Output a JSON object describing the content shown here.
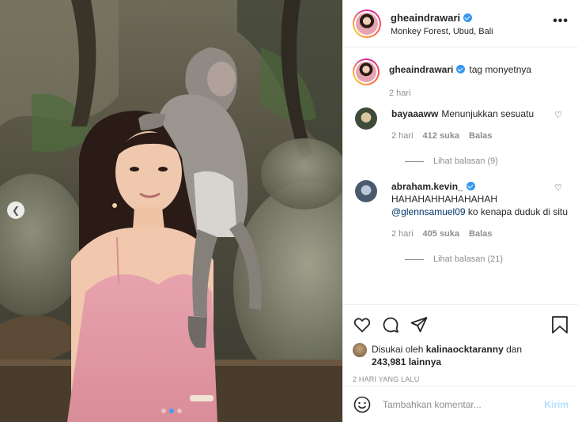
{
  "post": {
    "username": "gheaindrawari",
    "location": "Monkey Forest, Ubud, Bali",
    "more_label": "•••"
  },
  "caption": {
    "username": "gheaindrawari",
    "text": "tag monyetnya",
    "time": "2 hari"
  },
  "comments": [
    {
      "username": "bayaaaww",
      "text": "Menunjukkan sesuatu",
      "time": "2 hari",
      "likes": "412 suka",
      "reply": "Balas",
      "view_replies": "Lihat balasan (9)"
    },
    {
      "username": "abraham.kevin_",
      "text_line1": "HAHAHAHHAHAHAHAH",
      "mention": "@glennsamuel09",
      "text_rest": " ko kenapa duduk di situ",
      "time": "2 hari",
      "likes": "405 suka",
      "reply": "Balas",
      "view_replies": "Lihat balasan (21)"
    }
  ],
  "likes": {
    "prefix": "Disukai oleh ",
    "liker": "kalinaocktaranny",
    "middle": " dan ",
    "others": "243,981 lainnya"
  },
  "date": "2 HARI YANG LALU",
  "comment_box": {
    "placeholder": "Tambahkan komentar...",
    "post_label": "Kirim"
  },
  "carousel": {
    "prev_icon": "chevron-left-icon",
    "slide_count": 3,
    "active_index": 1
  },
  "colors": {
    "verified": "#3897f0",
    "mention": "#00376b",
    "post_disabled": "#b2dffc",
    "dot_active": "#3f9bf5"
  }
}
